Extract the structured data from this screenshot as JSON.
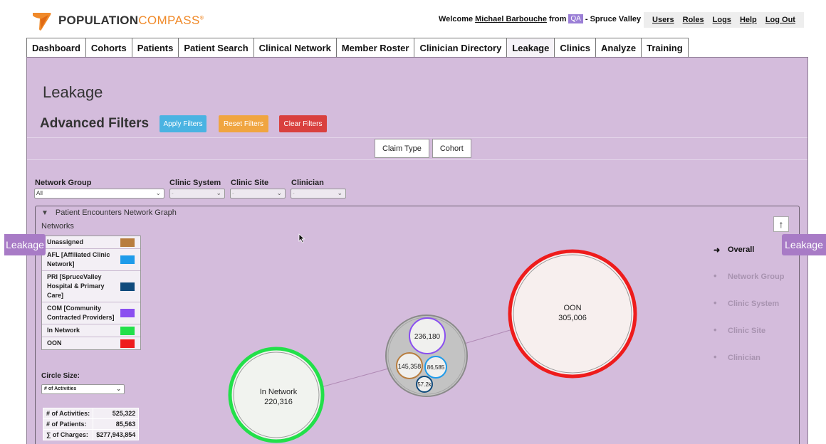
{
  "header": {
    "logo_bold": "POPULATION",
    "logo_light": "COMPASS",
    "logo_mark": "®",
    "welcome_prefix": "Welcome",
    "user_name": "Michael Barbouche",
    "from_text": "from",
    "env_badge": "QA",
    "org_text": "- Spruce Valley",
    "links": [
      "Users",
      "Roles",
      "Logs",
      "Help",
      "Log Out"
    ]
  },
  "tabs": [
    {
      "label": "Dashboard",
      "active": false
    },
    {
      "label": "Cohorts",
      "active": false
    },
    {
      "label": "Patients",
      "active": false
    },
    {
      "label": "Patient Search",
      "active": false
    },
    {
      "label": "Clinical Network",
      "active": false
    },
    {
      "label": "Member Roster",
      "active": false
    },
    {
      "label": "Clinician Directory",
      "active": false
    },
    {
      "label": "Leakage",
      "active": true
    },
    {
      "label": "Clinics",
      "active": false
    },
    {
      "label": "Analyze",
      "active": false
    },
    {
      "label": "Training",
      "active": false
    }
  ],
  "page": {
    "title": "Leakage",
    "advanced_filters": "Advanced Filters",
    "apply": "Apply Filters",
    "reset": "Reset Filters",
    "clear": "Clear Filters",
    "subtabs": [
      "Claim Type",
      "Cohort"
    ]
  },
  "filters": {
    "network_group": {
      "label": "Network Group",
      "value": "All"
    },
    "clinic_system": {
      "label": "Clinic System",
      "value": "-"
    },
    "clinic_site": {
      "label": "Clinic Site",
      "value": "-"
    },
    "clinician": {
      "label": "Clinician",
      "value": "-"
    }
  },
  "graph": {
    "section_title": "Patient Encounters Network Graph",
    "networks_label": "Networks",
    "legend": [
      {
        "label": "Unassigned",
        "color": "#b87d3e"
      },
      {
        "label": "AFL [Affiliated Clinic Network]",
        "color": "#1e9bea"
      },
      {
        "label": "PRI [SpruceValley Hospital & Primary Care]",
        "color": "#0f4a7c"
      },
      {
        "label": "COM [Community Contracted Providers]",
        "color": "#8a4ff0"
      },
      {
        "label": "In Network",
        "color": "#22e04a"
      },
      {
        "label": "OON",
        "color": "#ee1c1c"
      }
    ],
    "circle_size_label": "Circle Size:",
    "circle_size_value": "# of Activities",
    "stats": [
      {
        "label": "# of Activities:",
        "value": "525,322"
      },
      {
        "label": "# of Patients:",
        "value": "85,563"
      },
      {
        "label": "∑ of Charges:",
        "value": "$277,943,854"
      }
    ],
    "nodes": {
      "in_network": {
        "name": "In Network",
        "value": "220,316"
      },
      "oon": {
        "name": "OON",
        "value": "305,006"
      },
      "com": {
        "value": "236,180"
      },
      "unassigned": {
        "value": "145,358"
      },
      "afl": {
        "value": "86,585"
      },
      "pri": {
        "value": "57.2k"
      }
    },
    "levels": [
      {
        "label": "Overall",
        "active": true
      },
      {
        "label": "Network Group",
        "active": false
      },
      {
        "label": "Clinic System",
        "active": false
      },
      {
        "label": "Clinic Site",
        "active": false
      },
      {
        "label": "Clinician",
        "active": false
      }
    ],
    "up_arrow": "↑"
  },
  "side_tabs": {
    "left": "Leakage",
    "right": "Leakage"
  },
  "colors": {
    "panel": "#d4bcdc",
    "in_network_ring": "#22e04a",
    "oon_ring": "#ee1c1c",
    "accent_purple": "#a87bc6"
  }
}
